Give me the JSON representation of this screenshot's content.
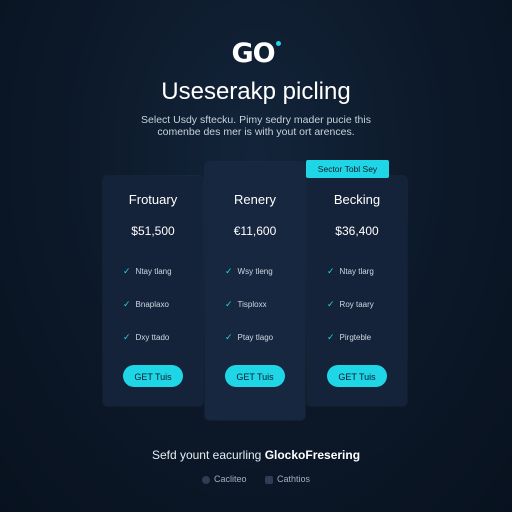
{
  "brand": {
    "logo": "GO"
  },
  "header": {
    "title": "Useserakp picling",
    "subtitle_line1": "Select Usdy sftecku. Pimy sedry mader pucie this",
    "subtitle_line2": "comenbe des mer is with yout ort arences."
  },
  "badge": "Sector Tobl Sey",
  "plans": [
    {
      "name": "Frotuary",
      "price": "$51,500",
      "features": [
        "Ntay tlang",
        "Bnaplaxo",
        "Dxy ttado"
      ],
      "cta": "GET Tuis"
    },
    {
      "name": "Renery",
      "price": "€11,600",
      "features": [
        "Wsy tleng",
        "Tisploxx",
        "Ptay tlago"
      ],
      "cta": "GET Tuis"
    },
    {
      "name": "Becking",
      "price": "$36,400",
      "features": [
        "Ntay tlarg",
        "Roy taary",
        "Pirgteble"
      ],
      "cta": "GET Tuis"
    }
  ],
  "footer": {
    "text_prefix": "Sefd yount eacurling",
    "text_bold": "GlockoFresering",
    "links": [
      "Cacliteo",
      "Cathtios"
    ]
  },
  "colors": {
    "accent": "#1fd6e6",
    "background": "#0c1828",
    "card": "#15233a"
  }
}
